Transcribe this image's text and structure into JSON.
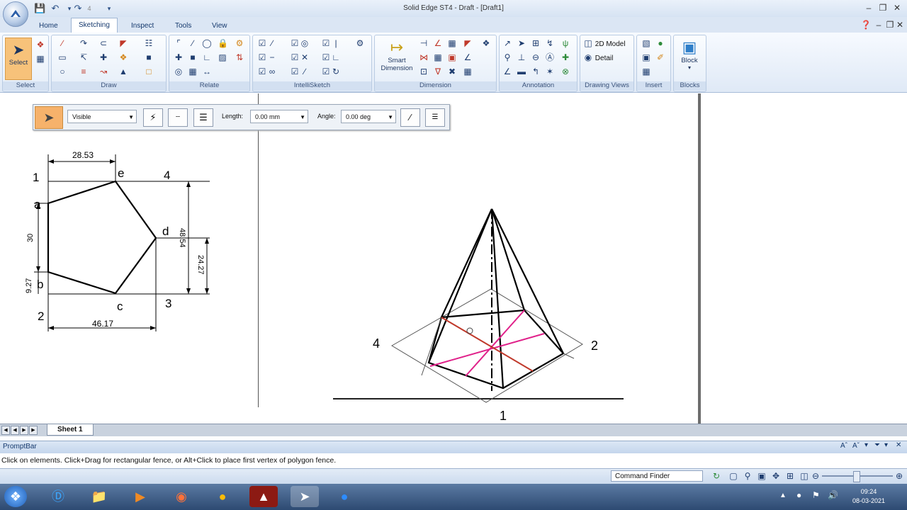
{
  "window": {
    "title": "Solid Edge ST4 - Draft - [Draft1]"
  },
  "qat": {
    "undo_count": "4"
  },
  "tabs": [
    "Home",
    "Sketching",
    "Inspect",
    "Tools",
    "View"
  ],
  "active_tab": "Sketching",
  "ribbon": {
    "groups": [
      "Select",
      "Draw",
      "Relate",
      "IntelliSketch",
      "Dimension",
      "Annotation",
      "Drawing Views",
      "Insert",
      "Blocks"
    ],
    "select_label": "Select",
    "smart_dimension_label": "Smart Dimension",
    "model_2d_label": "2D Model",
    "detail_label": "Detail",
    "block_label": "Block"
  },
  "floating_toolbar": {
    "line_style": "Visible",
    "length_label": "Length:",
    "length_value": "0.00 mm",
    "angle_label": "Angle:",
    "angle_value": "0.00 deg"
  },
  "drawing": {
    "dims": {
      "top": "28.53",
      "bottom": "46.17",
      "left_a": "30",
      "left_b": "9.27",
      "right_a": "48.54",
      "right_b": "24.27"
    },
    "labels": {
      "n1": "1",
      "n4": "4",
      "n2": "2",
      "n3": "3",
      "e": "e",
      "a": "a",
      "d": "d",
      "b": "b",
      "c": "c"
    },
    "pyramid_labels": {
      "p4": "4",
      "p2": "2",
      "p1": "1"
    }
  },
  "sheet_tab": "Sheet 1",
  "promptbar": {
    "title": "PromptBar",
    "message": "Click on elements. Click+Drag for rectangular fence, or Alt+Click to place first vertex of polygon fence."
  },
  "status": {
    "command_finder": "Command Finder"
  },
  "clock": {
    "time": "09:24",
    "date": "08-03-2021"
  }
}
